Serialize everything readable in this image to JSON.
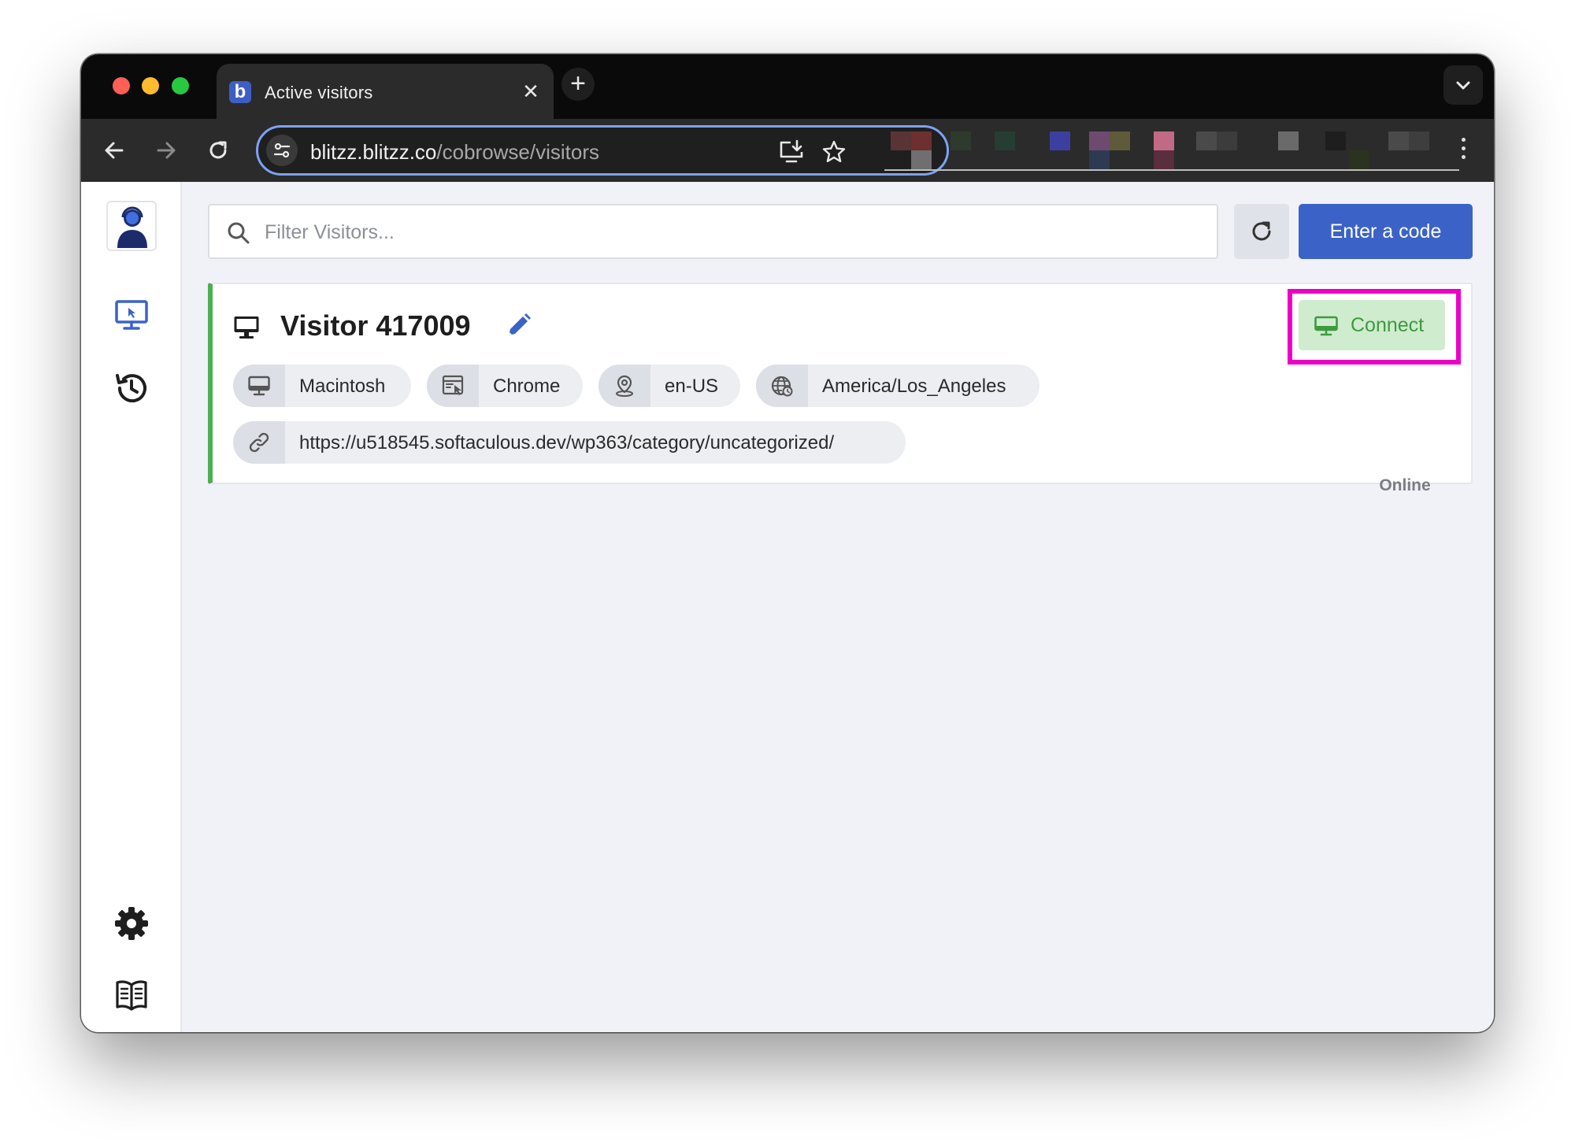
{
  "browser": {
    "tab_title": "Active visitors",
    "favicon_letter": "b",
    "url_host": "blitzz.blitzz.co",
    "url_path": "/cobrowse/visitors"
  },
  "search": {
    "placeholder": "Filter Visitors..."
  },
  "toolbar": {
    "enter_code_label": "Enter a code"
  },
  "visitor": {
    "name": "Visitor 417009",
    "os": "Macintosh",
    "browser": "Chrome",
    "locale": "en-US",
    "timezone": "America/Los_Angeles",
    "url": "https://u518545.softaculous.dev/wp363/category/uncategorized/",
    "connect_label": "Connect",
    "status": "Online"
  },
  "colors": {
    "accent": "#3b63c7",
    "online": "#4caf50",
    "highlight": "#ec00c8"
  }
}
